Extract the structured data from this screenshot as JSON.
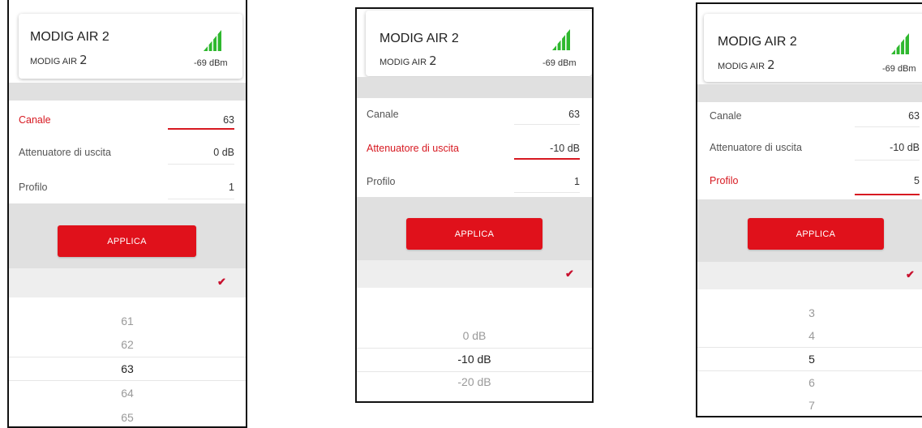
{
  "device": {
    "name": "MODIG AIR 2",
    "sub_label": "MODIG AIR",
    "sub_num": "2",
    "rssi": "-69 dBm",
    "signal_bars": 4
  },
  "colors": {
    "accent": "#e0111b",
    "signal": "#2eb82e",
    "band": "#e0e0e0"
  },
  "apply_label": "APPLICA",
  "check_icon": "check-icon",
  "screens": [
    {
      "fields": [
        {
          "label": "Canale",
          "value": "63",
          "active": true
        },
        {
          "label": "Attenuatore di uscita",
          "value": "0 dB",
          "active": false
        },
        {
          "label": "Profilo",
          "value": "1",
          "active": false
        }
      ],
      "picker": [
        "61",
        "62",
        "63",
        "64",
        "65"
      ],
      "picker_selected": "63"
    },
    {
      "fields": [
        {
          "label": "Canale",
          "value": "63",
          "active": false
        },
        {
          "label": "Attenuatore di uscita",
          "value": "-10 dB",
          "active": true
        },
        {
          "label": "Profilo",
          "value": "1",
          "active": false
        }
      ],
      "picker": [
        "0 dB",
        "-10 dB",
        "-20 dB"
      ],
      "picker_selected": "-10 dB"
    },
    {
      "fields": [
        {
          "label": "Canale",
          "value": "63",
          "active": false
        },
        {
          "label": "Attenuatore di uscita",
          "value": "-10 dB",
          "active": false
        },
        {
          "label": "Profilo",
          "value": "5",
          "active": true
        }
      ],
      "picker": [
        "3",
        "4",
        "5",
        "6",
        "7"
      ],
      "picker_selected": "5"
    }
  ]
}
